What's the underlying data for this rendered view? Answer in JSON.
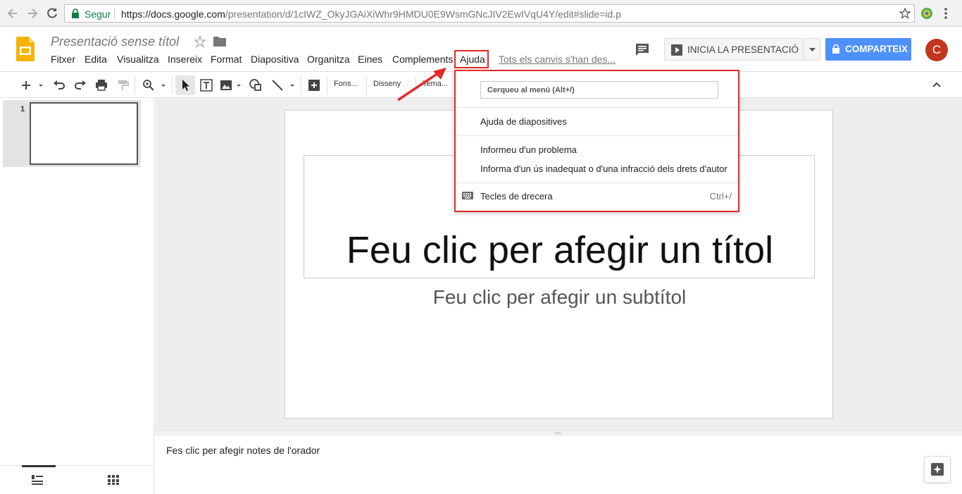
{
  "browser": {
    "secure_label": "Segur",
    "url_host": "https://docs.google.com",
    "url_path": "/presentation/d/1cIWZ_OkyJGAiXiWhr9HMDU0E9WsmGNcJIV2EwIVqU4Y/edit#slide=id.p"
  },
  "doc": {
    "title": "Presentació sense títol"
  },
  "menu": {
    "items": [
      "Fitxer",
      "Edita",
      "Visualitza",
      "Insereix",
      "Format",
      "Diapositiva",
      "Organitza",
      "Eines",
      "Complements",
      "Ajuda"
    ],
    "saved_status": "Tots els canvis s'han des..."
  },
  "header": {
    "present_label": "INICIA LA PRESENTACIÓ",
    "share_label": "COMPARTEIX",
    "avatar_letter": "C"
  },
  "toolbar": {
    "background_label": "Fons...",
    "layout_label": "Disseny",
    "theme_label": "Tema..."
  },
  "filmstrip": {
    "slide_number": "1"
  },
  "slide": {
    "title_placeholder": "Feu clic per afegir un títol",
    "subtitle_placeholder": "Feu clic per afegir un subtítol"
  },
  "notes": {
    "placeholder": "Fes clic per afegir notes de l'orador"
  },
  "help_menu": {
    "search_placeholder": "Cerqueu al menú (Alt+/)",
    "items": [
      "Ajuda de diapositives",
      "Informeu d'un problema",
      "Informa d'un ús inadequat o d'una infracció dels drets d'autor",
      "Tecles de drecera"
    ],
    "shortcut": "Ctrl+/"
  },
  "colors": {
    "accent_blue": "#4d90fe",
    "highlight_red": "#e52a2a",
    "avatar": "#c1361c",
    "slides_yellow": "#f4b400"
  }
}
